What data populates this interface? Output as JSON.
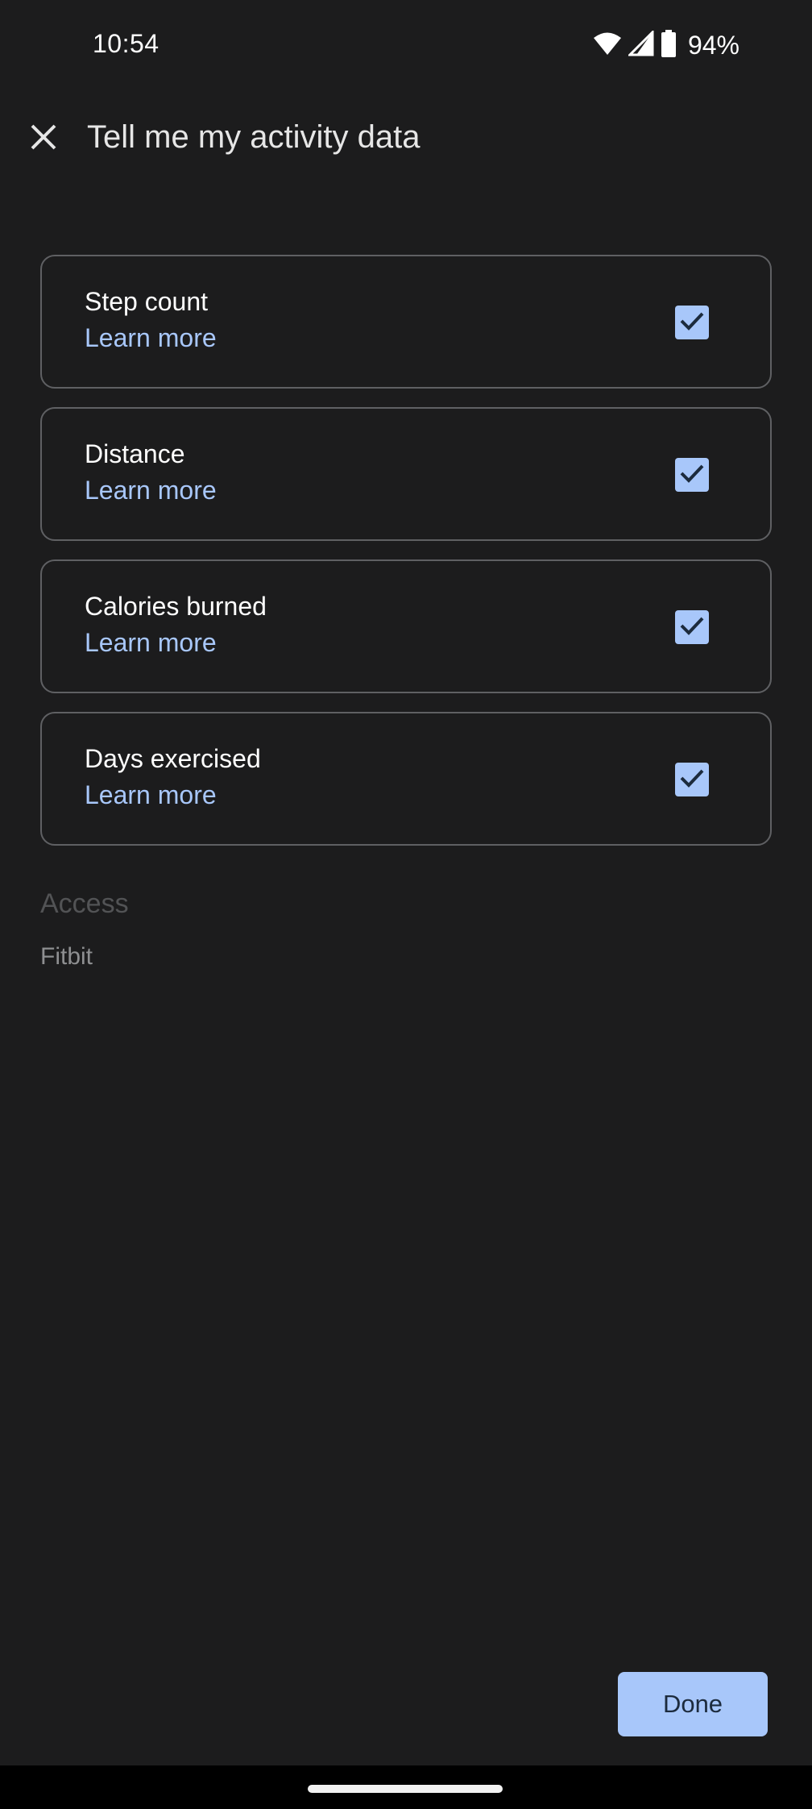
{
  "status_bar": {
    "time": "10:54",
    "battery_percent": "94%",
    "icons": [
      "wifi-icon",
      "cellular-signal-icon",
      "battery-icon"
    ]
  },
  "app_bar": {
    "close_icon": "close-icon",
    "title": "Tell me my activity data"
  },
  "cards": [
    {
      "title": "Step count",
      "link": "Learn more",
      "checked": true
    },
    {
      "title": "Distance",
      "link": "Learn more",
      "checked": true
    },
    {
      "title": "Calories burned",
      "link": "Learn more",
      "checked": true
    },
    {
      "title": "Days exercised",
      "link": "Learn more",
      "checked": true
    }
  ],
  "access": {
    "heading": "Access",
    "value": "Fitbit"
  },
  "actions": {
    "done_label": "Done"
  },
  "colors": {
    "background": "#1c1c1d",
    "accent": "#a8c7fa",
    "card_border": "#5f6063"
  }
}
